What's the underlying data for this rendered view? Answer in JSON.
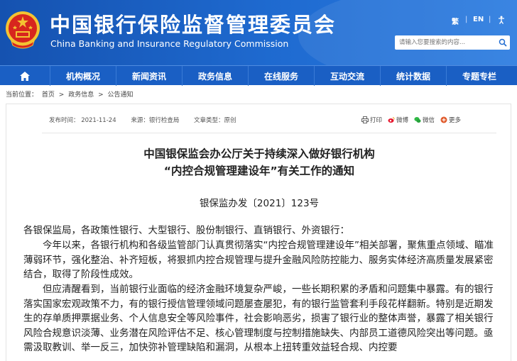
{
  "header": {
    "title_cn": "中国银行保险监督管理委员会",
    "title_en": "China Banking and Insurance Regulatory Commission",
    "lang_trad": "繁",
    "lang_en": "EN",
    "search_placeholder": "请输入您要搜索的内容..."
  },
  "nav": {
    "items": [
      "机构概况",
      "新闻资讯",
      "政务信息",
      "在线服务",
      "互动交流",
      "统计数据",
      "专题专栏"
    ]
  },
  "breadcrumb": {
    "prefix": "当前位置：",
    "items": [
      "首页",
      "政务信息",
      "公告通知"
    ],
    "separator": ">"
  },
  "article": {
    "published": "发布时间： 2021-11-24",
    "source": "来源：银行检查局",
    "type": "文章类型：原创",
    "share": {
      "print": "打印",
      "weibo": "微博",
      "wechat": "微信",
      "more": "更多"
    },
    "title_line1": "中国银保监会办公厅关于持续深入做好银行机构",
    "title_line2": "“内控合规管理建设年”有关工作的通知",
    "doc_number": "银保监办发〔2021〕123号",
    "salutation": "各银保监局，各政策性银行、大型银行、股份制银行、直销银行、外资银行：",
    "para1": "今年以来，各银行机构和各级监管部门认真贯彻落实“内控合规管理建设年”相关部署，聚焦重点领域、瞄准薄弱环节，强化整治、补齐短板，将狠抓内控合规管理与提升金融风险防控能力、服务实体经济高质量发展紧密结合，取得了阶段性成效。",
    "para2": "但应清醒看到，当前银行业面临的经济金融环境复杂严峻，一些长期积累的矛盾和问题集中暴露。有的银行落实国家宏观政策不力，有的银行授信管理领域问题屡查屡犯，有的银行监管套利手段花样翻新。特别是近期发生的存单质押票据业务、个人信息安全等风险事件，社会影响恶劣，损害了银行业的整体声誉，暴露了相关银行风险合规意识淡薄、业务潜在风险评估不足、核心管理制度与控制措施缺失、内部员工道德风险突出等问题。亟需汲取教训、举一反三，加快弥补管理缺陷和漏洞，从根本上扭转重效益轻合规、内控要"
  },
  "colors": {
    "header_blue": "#1f6bd1",
    "nav_blue": "#1a5fc4",
    "emblem_red": "#d7261e",
    "emblem_gold": "#f3c332"
  }
}
